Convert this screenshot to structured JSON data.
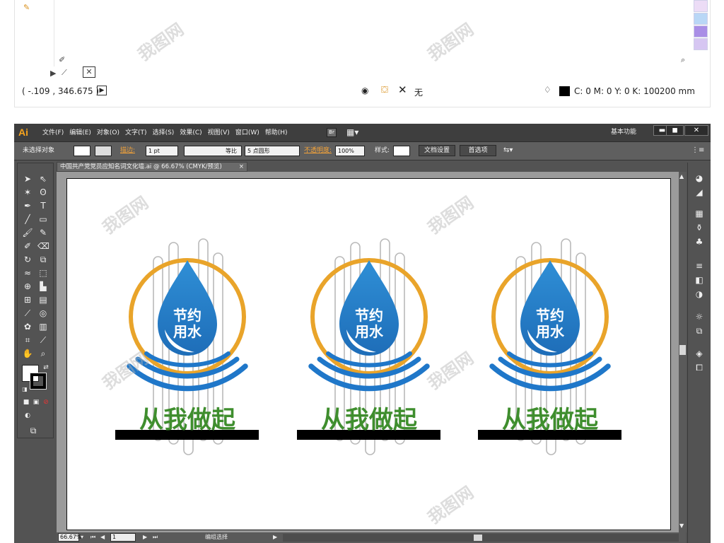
{
  "top": {
    "coords": "( -.109 , 346.675 )",
    "fill_label": "无",
    "color_readout": "C: 0 M: 0 Y: 0 K: 100",
    "stroke_readout": ".200 mm"
  },
  "menubar": {
    "logo": "Ai",
    "items": [
      "文件(F)",
      "编辑(E)",
      "对象(O)",
      "文字(T)",
      "选择(S)",
      "效果(C)",
      "视图(V)",
      "窗口(W)",
      "帮助(H)"
    ],
    "bridge_label": "Br",
    "workspace": "基本功能",
    "minimize": "▬",
    "maximize": "◼",
    "close": "✕"
  },
  "controlbar": {
    "selection": "未选择对象",
    "stroke_label": "描边:",
    "stroke_weight": "1 pt",
    "stroke_profile": "等比",
    "brush": "5 点圆形",
    "opacity_label": "不透明度:",
    "opacity": "100%",
    "style_label": "样式:",
    "doc_setup": "文档设置",
    "preferences": "首选项"
  },
  "document": {
    "tab_title": "中国共产党党员应知名词文化墙.ai @ 66.67% (CMYK/预览)",
    "tab_close": "×"
  },
  "artwork": {
    "drop_text_line1": "节约",
    "drop_text_line2": "用水",
    "slogan": "从我做起",
    "colors": {
      "ring": "#E9A42A",
      "drop_top": "#2F8FD6",
      "drop_bottom": "#1E6DB8",
      "wave": "#1F77C9",
      "slogan": "#3F8E2E",
      "base": "#000000"
    }
  },
  "statusbar": {
    "zoom": "66.67%",
    "page": "1",
    "mode": "编组选择"
  },
  "watermark": "我图网"
}
